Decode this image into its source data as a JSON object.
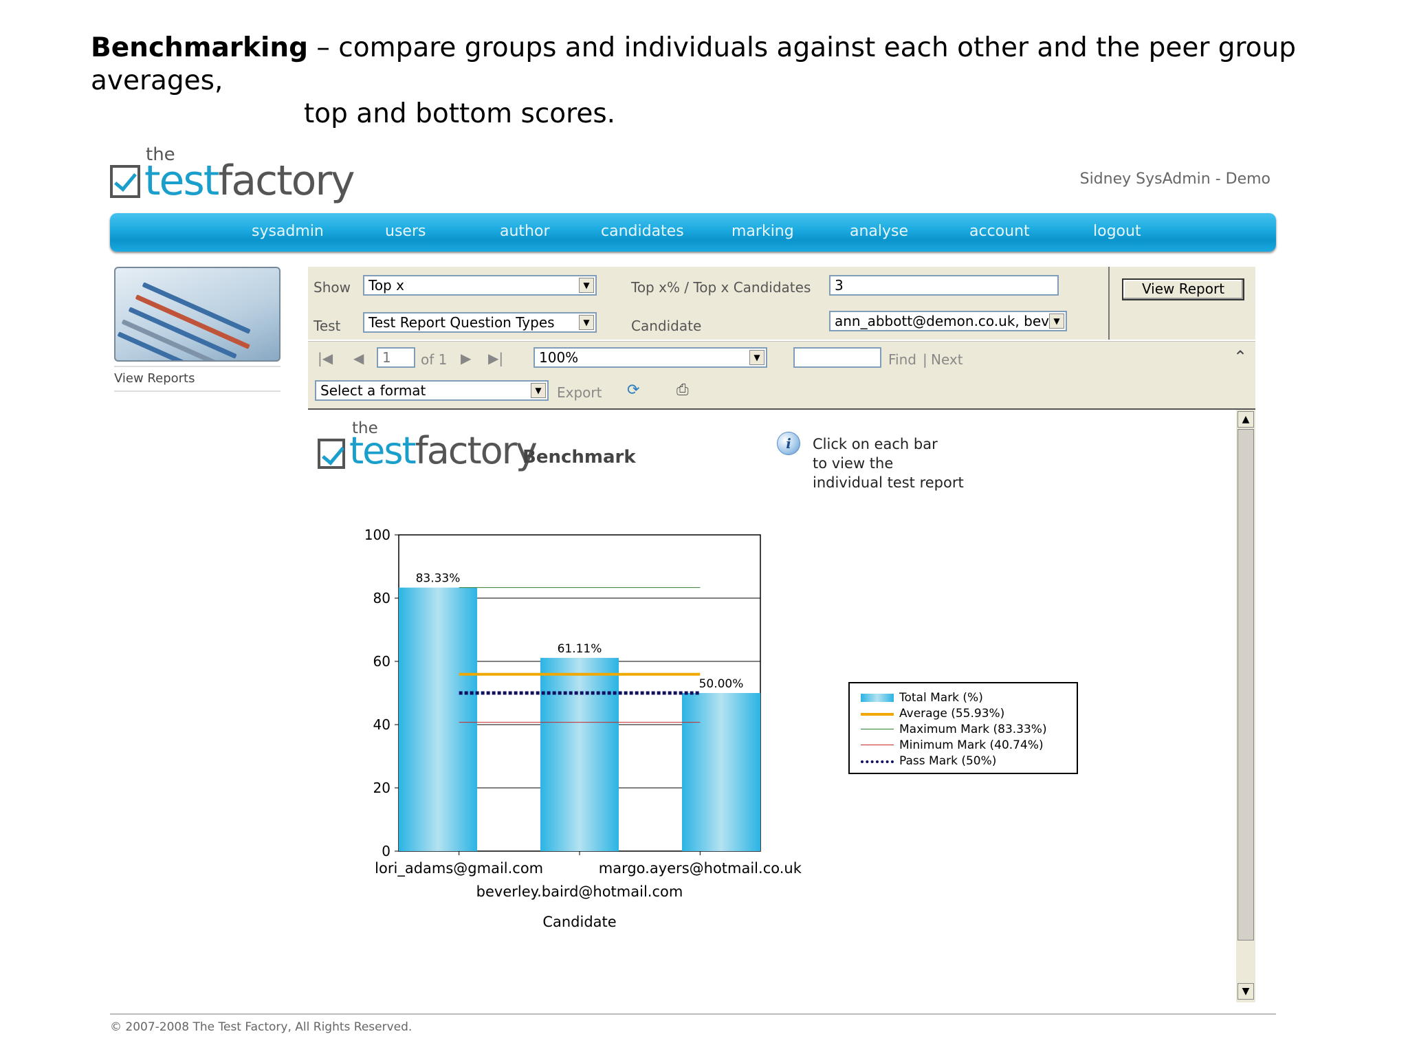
{
  "slide": {
    "title_bold": "Benchmarking",
    "title_rest": " – compare groups and individuals against each other and the peer group averages,",
    "title_line2": "top and bottom scores."
  },
  "app": {
    "logo_the": "the",
    "logo_test": "test",
    "logo_factory": "factory",
    "user": "Sidney SysAdmin - Demo"
  },
  "nav": {
    "items": [
      "sysadmin",
      "users",
      "author",
      "candidates",
      "marking",
      "analyse",
      "account",
      "logout"
    ]
  },
  "sidebar": {
    "link": "View Reports"
  },
  "params": {
    "show_label": "Show",
    "show_value": "Top x",
    "top_label": "Top x% / Top x Candidates",
    "top_value": "3",
    "test_label": "Test",
    "test_value": "Test Report Question Types",
    "candidate_label": "Candidate",
    "candidate_value": "ann_abbott@demon.co.uk, beve",
    "view_report": "View Report"
  },
  "toolbar": {
    "page_value": "1",
    "page_of": "of 1",
    "zoom": "100%",
    "find_value": "",
    "find": "Find",
    "separator": "|",
    "next": "Next",
    "format": "Select a format",
    "export": "Export"
  },
  "report": {
    "logo_the": "the",
    "logo_test": "test",
    "logo_factory": "factory",
    "benchmark": "Benchmark",
    "hint": "Click on each bar\nto view the\nindividual test report"
  },
  "chart_data": {
    "type": "bar",
    "categories": [
      "lori_adams@gmail.com",
      "beverley.baird@hotmail.com",
      "margo.ayers@hotmail.co.uk"
    ],
    "values": [
      83.33,
      61.11,
      50.0
    ],
    "value_labels": [
      "83.33%",
      "61.11%",
      "50.00%"
    ],
    "ylim": [
      0,
      100
    ],
    "yticks": [
      0,
      20,
      40,
      60,
      80,
      100
    ],
    "xlabel": "Candidate",
    "reference_lines": [
      {
        "name": "Average (55.93%)",
        "value": 55.93,
        "color": "#f0a800",
        "style": "solid-thick"
      },
      {
        "name": "Maximum Mark (83.33%)",
        "value": 83.33,
        "color": "#2e7d32",
        "style": "thin"
      },
      {
        "name": "Minimum Mark (40.74%)",
        "value": 40.74,
        "color": "#c62828",
        "style": "thin"
      },
      {
        "name": "Pass Mark (50%)",
        "value": 50,
        "color": "#101060",
        "style": "dotted"
      }
    ],
    "legend": [
      "Total Mark (%)",
      "Average (55.93%)",
      "Maximum Mark (83.33%)",
      "Minimum Mark (40.74%)",
      "Pass Mark (50%)"
    ],
    "legend_position": "right",
    "bar_color": "#29b6e6",
    "grid": true
  },
  "footer": {
    "copyright": "© 2007-2008 The Test Factory, All Rights Reserved."
  }
}
